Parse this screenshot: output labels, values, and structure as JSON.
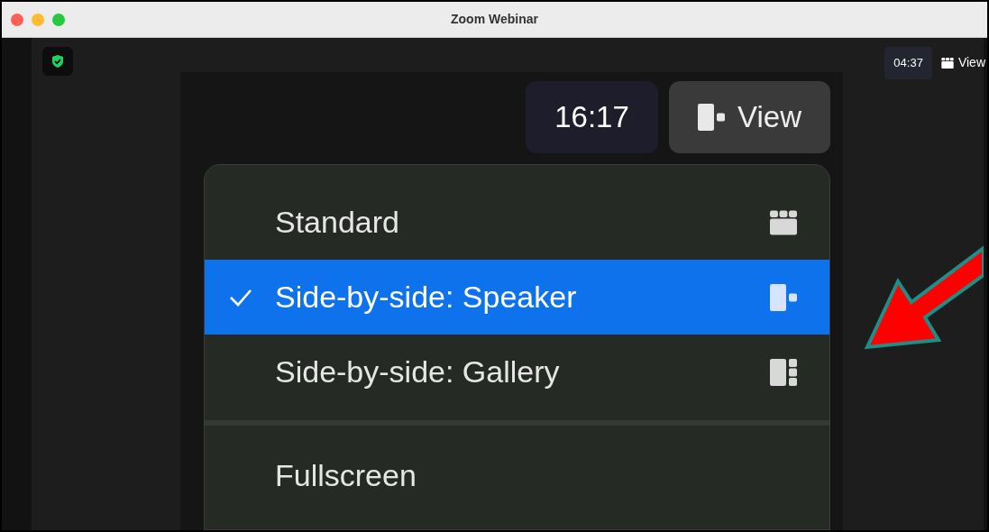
{
  "window": {
    "title": "Zoom Webinar"
  },
  "toolbar": {
    "timer": "04:37",
    "view_button": "View"
  },
  "zoomed_view": {
    "timer": "16:17",
    "view_button": "View",
    "menu": {
      "items": [
        {
          "kind": "option",
          "label": "Standard",
          "selected": false
        },
        {
          "kind": "option",
          "label": "Side-by-side: Speaker",
          "selected": true
        },
        {
          "kind": "option",
          "label": "Side-by-side: Gallery",
          "selected": false
        },
        {
          "kind": "divider"
        },
        {
          "kind": "option",
          "label": "Fullscreen",
          "selected": false
        }
      ]
    }
  }
}
